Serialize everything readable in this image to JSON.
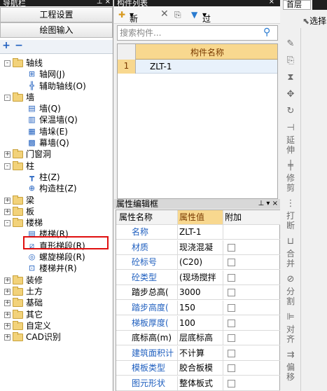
{
  "left": {
    "header": "导航栏",
    "buttons": [
      "工程设置",
      "绘图输入"
    ],
    "tree": [
      {
        "label": "轴线",
        "level": 0,
        "exp": "-",
        "folder": true
      },
      {
        "label": "轴网(J)",
        "level": 1,
        "icon": "grid-icon"
      },
      {
        "label": "辅助轴线(O)",
        "level": 1,
        "icon": "aux-axis-icon"
      },
      {
        "label": "墙",
        "level": 0,
        "exp": "-",
        "folder": true
      },
      {
        "label": "墙(Q)",
        "level": 1,
        "icon": "wall-icon"
      },
      {
        "label": "保温墙(Q)",
        "level": 1,
        "icon": "insulation-wall-icon"
      },
      {
        "label": "墙垛(E)",
        "level": 1,
        "icon": "wall-pier-icon"
      },
      {
        "label": "幕墙(Q)",
        "level": 1,
        "icon": "curtain-wall-icon"
      },
      {
        "label": "门窗洞",
        "level": 0,
        "exp": "+",
        "folder": true
      },
      {
        "label": "柱",
        "level": 0,
        "exp": "-",
        "folder": true
      },
      {
        "label": "柱(Z)",
        "level": 1,
        "icon": "column-icon"
      },
      {
        "label": "构造柱(Z)",
        "level": 1,
        "icon": "constructional-column-icon"
      },
      {
        "label": "梁",
        "level": 0,
        "exp": "+",
        "folder": true
      },
      {
        "label": "板",
        "level": 0,
        "exp": "+",
        "folder": true
      },
      {
        "label": "楼梯",
        "level": 0,
        "exp": "-",
        "folder": true
      },
      {
        "label": "楼梯(R)",
        "level": 1,
        "icon": "stair-icon"
      },
      {
        "label": "直形梯段(R)",
        "level": 1,
        "icon": "straight-flight-icon"
      },
      {
        "label": "螺旋梯段(R)",
        "level": 1,
        "icon": "spiral-flight-icon"
      },
      {
        "label": "楼梯井(R)",
        "level": 1,
        "icon": "stair-well-icon"
      },
      {
        "label": "装修",
        "level": 0,
        "exp": "+",
        "folder": true
      },
      {
        "label": "土方",
        "level": 0,
        "exp": "+",
        "folder": true
      },
      {
        "label": "基础",
        "level": 0,
        "exp": "+",
        "folder": true
      },
      {
        "label": "其它",
        "level": 0,
        "exp": "+",
        "folder": true
      },
      {
        "label": "自定义",
        "level": 0,
        "exp": "+",
        "folder": true
      },
      {
        "label": "CAD识别",
        "level": 0,
        "exp": "+",
        "folder": true
      }
    ]
  },
  "mid": {
    "header": "构件列表",
    "toolbar": {
      "new": "新建",
      "filter": "过滤"
    },
    "search_placeholder": "搜索构件...",
    "list": {
      "col": "构件名称",
      "rows": [
        {
          "idx": "1",
          "name": "ZLT-1"
        }
      ]
    },
    "prop": {
      "header": "属性编辑框",
      "cols": [
        "属性名称",
        "属性值",
        "附加"
      ],
      "rows": [
        {
          "name": "名称",
          "value": "ZLT-1",
          "blue": true,
          "cb": false
        },
        {
          "name": "材质",
          "value": "现浇混凝",
          "blue": true,
          "cb": true
        },
        {
          "name": "砼标号",
          "value": "(C20)",
          "blue": true,
          "cb": true
        },
        {
          "name": "砼类型",
          "value": "(现场搅拌",
          "blue": true,
          "cb": true
        },
        {
          "name": "踏步总高(",
          "value": "3000",
          "blue": false,
          "cb": true
        },
        {
          "name": "踏步高度(",
          "value": "150",
          "blue": true,
          "cb": true
        },
        {
          "name": "梯板厚度(",
          "value": "100",
          "blue": true,
          "cb": true
        },
        {
          "name": "底标高(m)",
          "value": "层底标高",
          "blue": false,
          "cb": true
        },
        {
          "name": "建筑面积计",
          "value": "不计算",
          "blue": true,
          "cb": true
        },
        {
          "name": "模板类型",
          "value": "胶合板模",
          "blue": true,
          "cb": true
        },
        {
          "name": "图元形状",
          "value": "整体板式",
          "blue": true,
          "cb": true
        }
      ]
    }
  },
  "right": {
    "floor": "首层",
    "select": "选择",
    "tools": [
      {
        "icon": "pen-icon",
        "t": ""
      },
      {
        "icon": "copy-icon",
        "t": ""
      },
      {
        "icon": "mirror-icon",
        "t": ""
      },
      {
        "icon": "move-icon",
        "t": ""
      },
      {
        "icon": "rotate-icon",
        "t": ""
      },
      {
        "icon": "extend-icon",
        "t": "延伸"
      },
      {
        "icon": "trim-icon",
        "t": "修剪"
      },
      {
        "icon": "break-icon",
        "t": "打断"
      },
      {
        "icon": "merge-icon",
        "t": "合并"
      },
      {
        "icon": "split-icon",
        "t": "分割"
      },
      {
        "icon": "align-icon",
        "t": "对齐"
      },
      {
        "icon": "offset-icon",
        "t": "偏移"
      }
    ]
  }
}
